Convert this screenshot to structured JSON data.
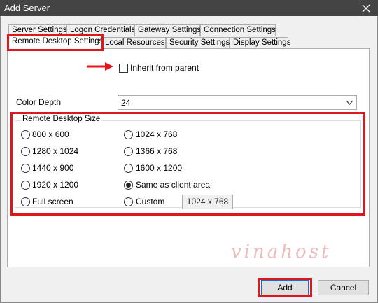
{
  "window": {
    "title": "Add Server"
  },
  "tabs_row1": [
    "Server Settings",
    "Logon Credentials",
    "Gateway Settings",
    "Connection Settings"
  ],
  "tabs_row2": [
    "Remote Desktop Settings",
    "Local Resources",
    "Security Settings",
    "Display Settings"
  ],
  "inherit": {
    "label": "Inherit from parent",
    "checked": false
  },
  "color_depth": {
    "label": "Color Depth",
    "value": "24"
  },
  "rd_size": {
    "title": "Remote Desktop Size",
    "options": [
      "800 x 600",
      "1280 x 1024",
      "1440 x 900",
      "1920 x 1200",
      "Full screen",
      "1024 x 768",
      "1366 x 768",
      "1600 x 1200",
      "Same as client area",
      "Custom"
    ],
    "selected": "Same as client area",
    "custom_value": "1024 x 768"
  },
  "buttons": {
    "add": "Add",
    "cancel": "Cancel"
  },
  "watermark": "vinahost",
  "colors": {
    "highlight": "#e0161d",
    "titlebar": "#444444"
  }
}
